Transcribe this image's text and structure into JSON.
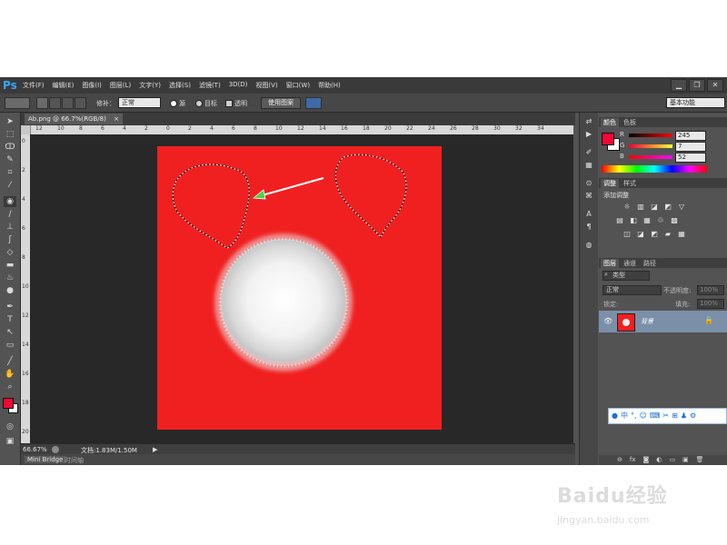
{
  "app": {
    "logo": "Ps",
    "window_controls": [
      "▁",
      "❐",
      "✕"
    ]
  },
  "menu": [
    "文件(F)",
    "编辑(E)",
    "图像(I)",
    "图层(L)",
    "文字(Y)",
    "选择(S)",
    "滤镜(T)",
    "3D(D)",
    "视图(V)",
    "窗口(W)",
    "帮助(H)"
  ],
  "options": {
    "feather_label": "修补：",
    "mode_value": "正常",
    "source_label": "源",
    "target_label": "目标",
    "transparent_label": "透明",
    "use_pattern_label": "使用图案",
    "workspace": "基本功能"
  },
  "document": {
    "tab_title": "Ab.png @ 66.7%(RGB/8)",
    "tab_close": "×",
    "canvas_color": "#f12020",
    "ruler_h_labels": [
      "12",
      "10",
      "8",
      "6",
      "4",
      "2",
      "0",
      "2",
      "4",
      "6",
      "8",
      "10",
      "12",
      "14",
      "16",
      "18",
      "20",
      "22",
      "24",
      "26",
      "28",
      "30",
      "32",
      "34"
    ],
    "ruler_v_labels": [
      "0",
      "2",
      "4",
      "6",
      "8",
      "10",
      "12",
      "14",
      "16",
      "18",
      "20"
    ]
  },
  "status": {
    "zoom": "66.67%",
    "doc_info": "文档:1.83M/1.50M"
  },
  "bottom_tabs": [
    "Mini Bridge",
    "时间轴"
  ],
  "color_panel": {
    "tabs": [
      "颜色",
      "色板"
    ],
    "channels": [
      {
        "label": "R",
        "value": "245"
      },
      {
        "label": "G",
        "value": "7"
      },
      {
        "label": "B",
        "value": "52"
      }
    ],
    "foreground": "#f50734",
    "background": "#ffffff"
  },
  "adjustments_panel": {
    "tabs": [
      "调整",
      "样式"
    ],
    "title": "添加调整",
    "icons_row1": [
      "☼",
      "▥",
      "◪",
      "◩",
      "▽"
    ],
    "icons_row2": [
      "▤",
      "◧",
      "▦",
      "♲",
      "▩"
    ],
    "icons_row3": [
      "◫",
      "◪",
      "◩",
      "▰",
      "▦"
    ]
  },
  "layers_panel": {
    "tabs": [
      "图层",
      "通道",
      "路径"
    ],
    "filter_kind": "类型",
    "blend_mode": "正常",
    "opacity_label": "不透明度:",
    "opacity_value": "100%",
    "lock_label": "锁定:",
    "fill_label": "填充:",
    "fill_value": "100%",
    "layer_name": "背景",
    "footer_icons": [
      "⊖",
      "fx",
      "◙",
      "◐",
      "▭",
      "▣",
      "🗑"
    ]
  },
  "ime_bar": [
    "●",
    "中",
    "°,",
    "☺",
    "⌨",
    "✂",
    "⊞",
    "♟",
    "⚙"
  ],
  "watermark": {
    "main": "Baidu经验",
    "sub": "jingyan.baidu.com"
  }
}
